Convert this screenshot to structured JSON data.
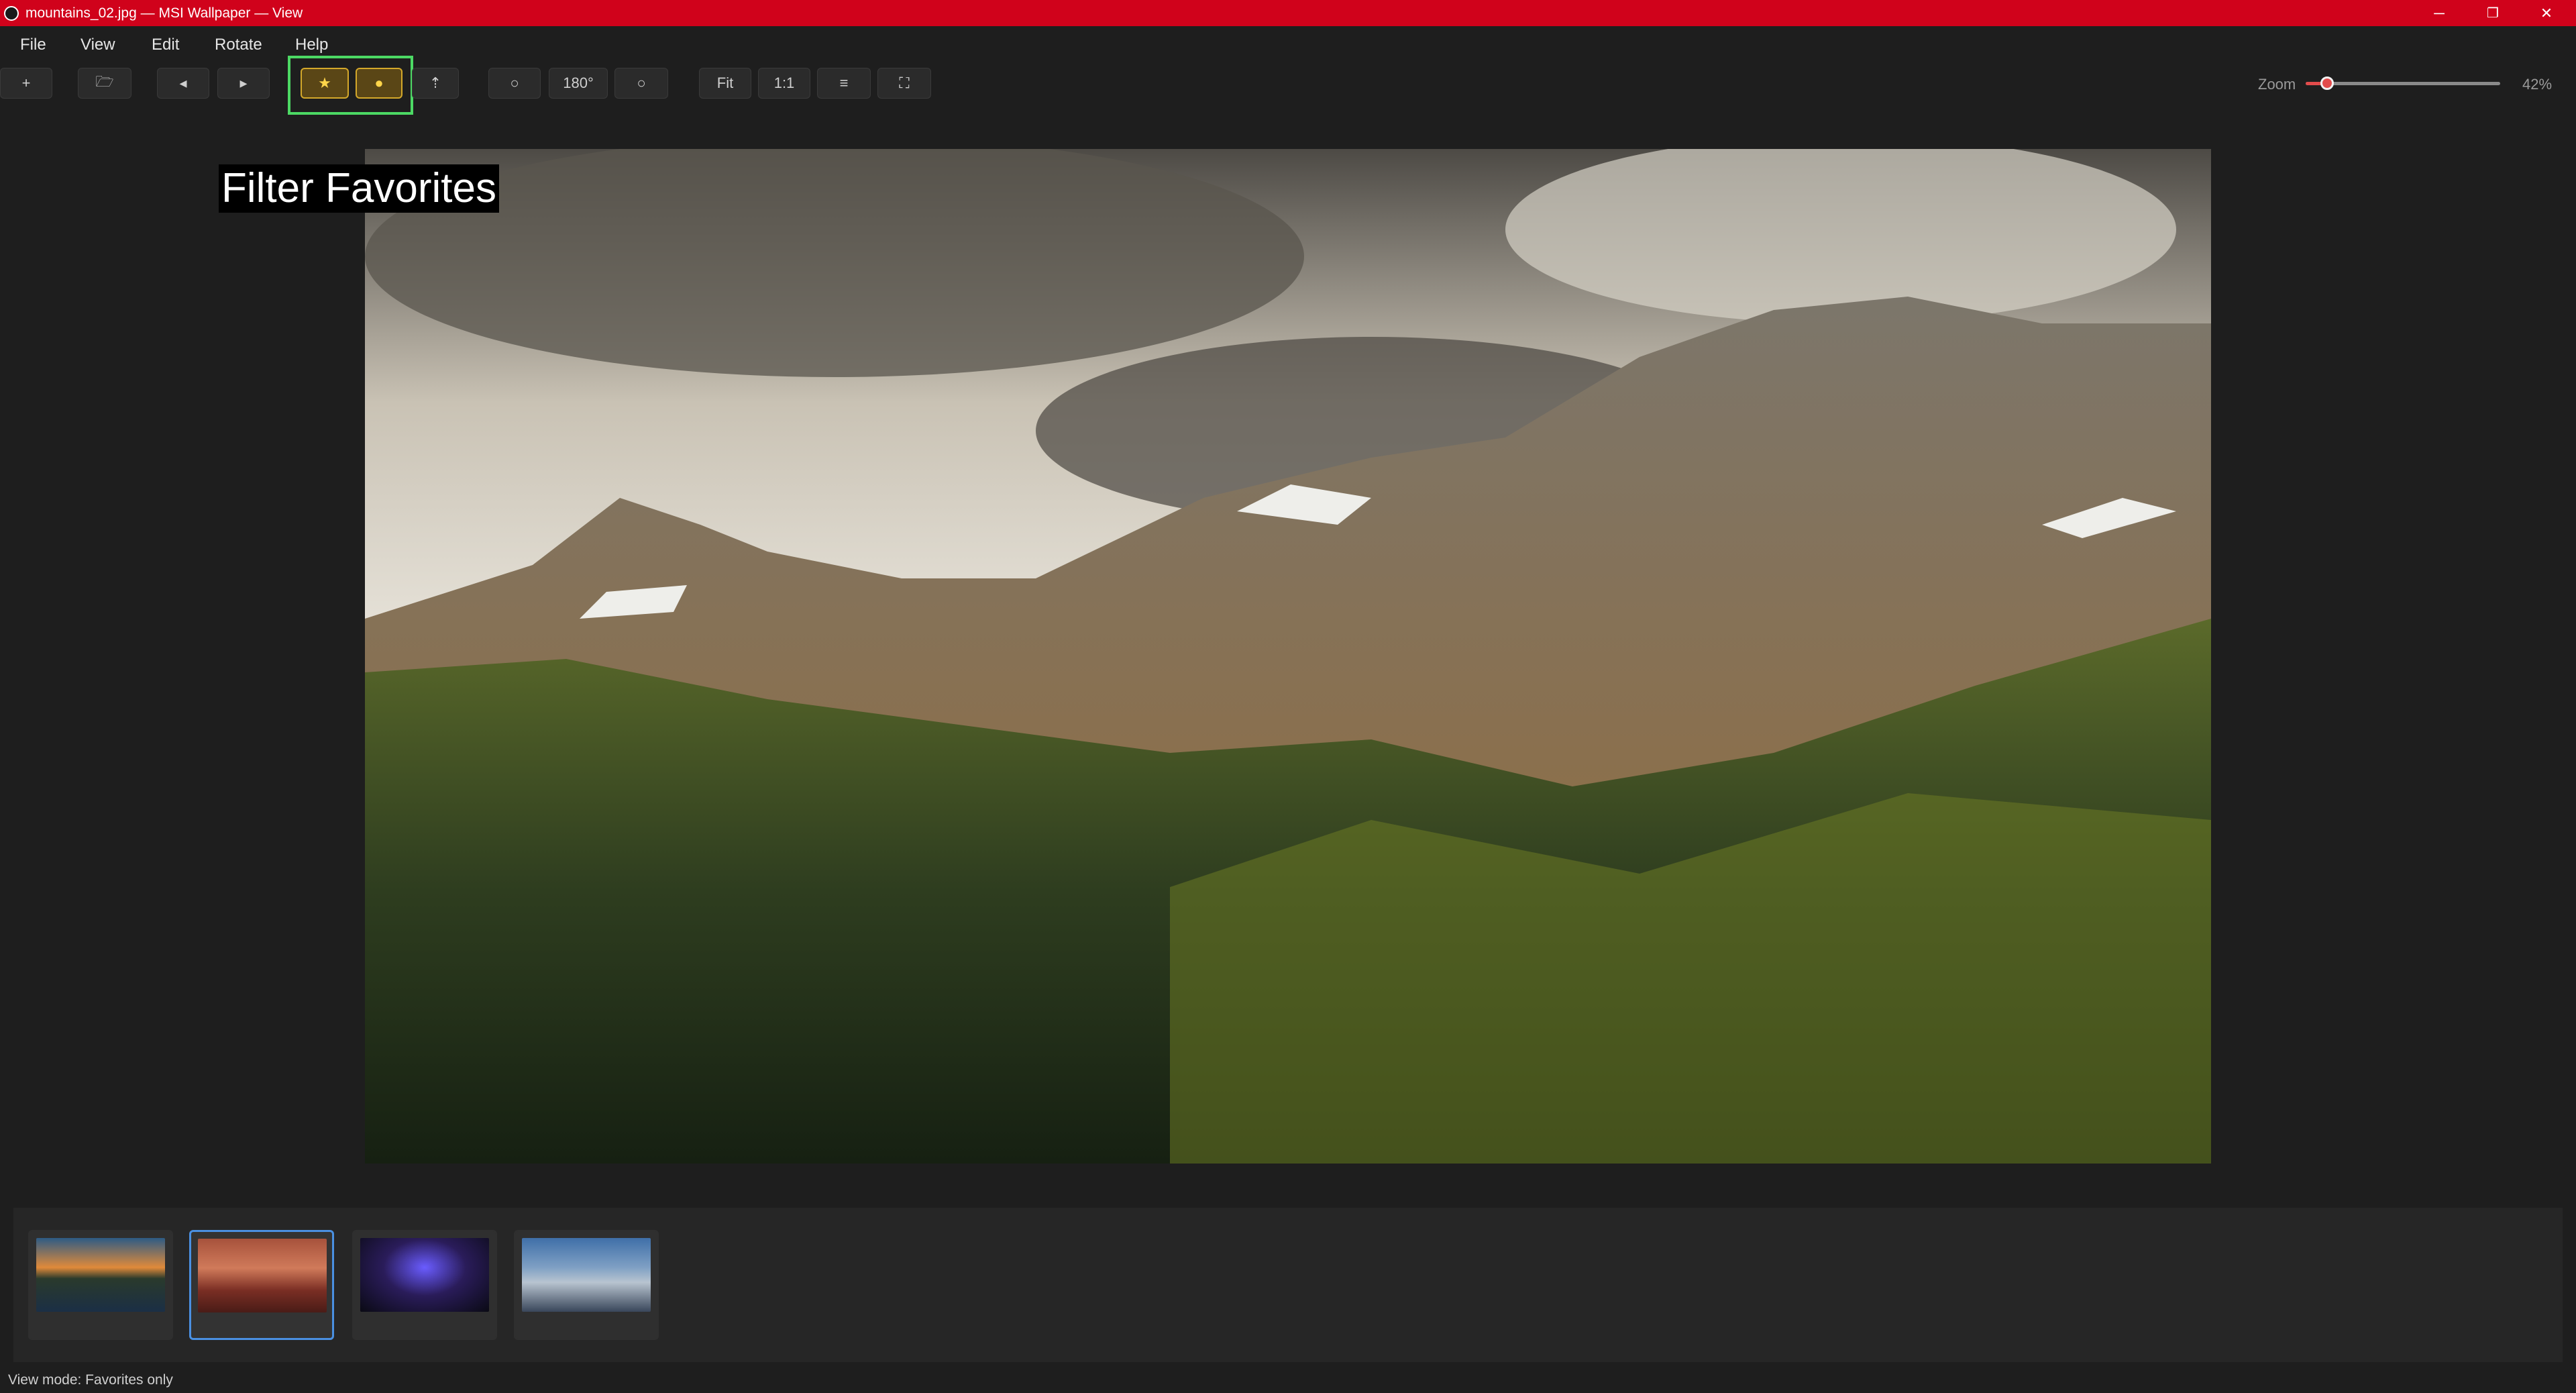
{
  "window": {
    "title": "mountains_02.jpg  —  MSI Wallpaper  —  View",
    "controls": {
      "minimize": "─",
      "restore": "❐",
      "close": "✕"
    }
  },
  "menu": {
    "items": [
      "File",
      "View",
      "Edit",
      "Rotate",
      "Help"
    ]
  },
  "toolbar": {
    "add": "+",
    "open": "🗁",
    "prev": "◂",
    "next": "▸",
    "favorite": "★",
    "filter_favorites": "●",
    "share": "⇡",
    "rotate_left": "○",
    "rotate_180": "180°",
    "rotate_right": "○",
    "fit": "Fit",
    "actual_size": "1:1",
    "menu": "≡",
    "fullscreen": "⛶",
    "zoom_label": "Zoom",
    "zoom_percent": 42,
    "zoom_value": "42%",
    "accent": "#e24b4b",
    "highlight_color": "#4cd964"
  },
  "viewer": {
    "overlay_label": "Filter Favorites"
  },
  "filmstrip": {
    "thumbnails": [
      {
        "name": "lake-reflection",
        "selected": false
      },
      {
        "name": "red-mountains",
        "selected": true
      },
      {
        "name": "msi-stage",
        "selected": false
      },
      {
        "name": "misty-mountains",
        "selected": false
      }
    ],
    "selected_color": "#4a90e2"
  },
  "status": {
    "text": "View mode: Favorites only"
  }
}
